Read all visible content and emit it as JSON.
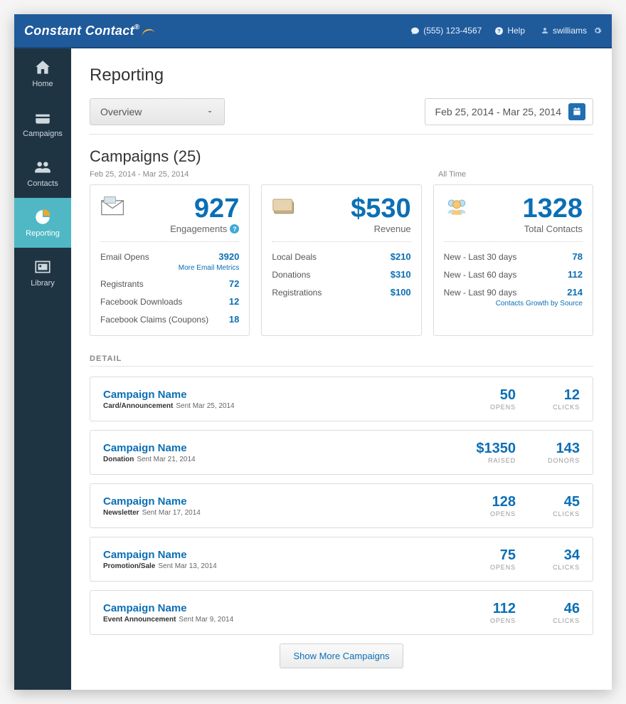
{
  "topbar": {
    "brand": "Constant Contact",
    "phone": "(555) 123-4567",
    "help": "Help",
    "user": "swilliams"
  },
  "sidenav": [
    {
      "key": "home",
      "label": "Home"
    },
    {
      "key": "campaigns",
      "label": "Campaigns"
    },
    {
      "key": "contacts",
      "label": "Contacts"
    },
    {
      "key": "reporting",
      "label": "Reporting"
    },
    {
      "key": "library",
      "label": "Library"
    }
  ],
  "active_nav": "reporting",
  "page": {
    "title": "Reporting",
    "view_selector": "Overview",
    "date_range_text": "Feb 25, 2014 - Mar 25, 2014"
  },
  "campaigns_header": {
    "title": "Campaigns (25)",
    "left_range": "Feb 25, 2014 - Mar 25, 2014",
    "right_range": "All Time"
  },
  "cards": {
    "engagements": {
      "value": "927",
      "label": "Engagements",
      "sublink": "More Email Metrics",
      "rows": [
        {
          "name": "Email Opens",
          "value": "3920"
        },
        {
          "name": "Registrants",
          "value": "72"
        },
        {
          "name": "Facebook Downloads",
          "value": "12"
        },
        {
          "name": "Facebook Claims (Coupons)",
          "value": "18"
        }
      ]
    },
    "revenue": {
      "value": "$530",
      "label": "Revenue",
      "rows": [
        {
          "name": "Local Deals",
          "value": "$210"
        },
        {
          "name": "Donations",
          "value": "$310"
        },
        {
          "name": "Registrations",
          "value": "$100"
        }
      ]
    },
    "contacts": {
      "value": "1328",
      "label": "Total Contacts",
      "sublink": "Contacts Growth by Source",
      "rows": [
        {
          "name": "New - Last 30 days",
          "value": "78"
        },
        {
          "name": "New - Last 60 days",
          "value": "112"
        },
        {
          "name": "New - Last 90 days",
          "value": "214"
        }
      ]
    }
  },
  "detail": {
    "heading": "DETAIL",
    "rows": [
      {
        "title": "Campaign Name",
        "type": "Card/Announcement",
        "sent": "Sent Mar 25, 2014",
        "m1v": "50",
        "m1l": "OPENS",
        "m2v": "12",
        "m2l": "CLICKS"
      },
      {
        "title": "Campaign Name",
        "type": "Donation",
        "sent": "Sent Mar 21, 2014",
        "m1v": "$1350",
        "m1l": "RAISED",
        "m2v": "143",
        "m2l": "DONORS"
      },
      {
        "title": "Campaign Name",
        "type": "Newsletter",
        "sent": "Sent Mar 17, 2014",
        "m1v": "128",
        "m1l": "OPENS",
        "m2v": "45",
        "m2l": "CLICKS"
      },
      {
        "title": "Campaign Name",
        "type": "Promotion/Sale",
        "sent": "Sent Mar 13, 2014",
        "m1v": "75",
        "m1l": "OPENS",
        "m2v": "34",
        "m2l": "CLICKS"
      },
      {
        "title": "Campaign Name",
        "type": "Event Announcement",
        "sent": "Sent Mar 9, 2014",
        "m1v": "112",
        "m1l": "OPENS",
        "m2v": "46",
        "m2l": "CLICKS"
      }
    ],
    "show_more": "Show More Campaigns"
  }
}
